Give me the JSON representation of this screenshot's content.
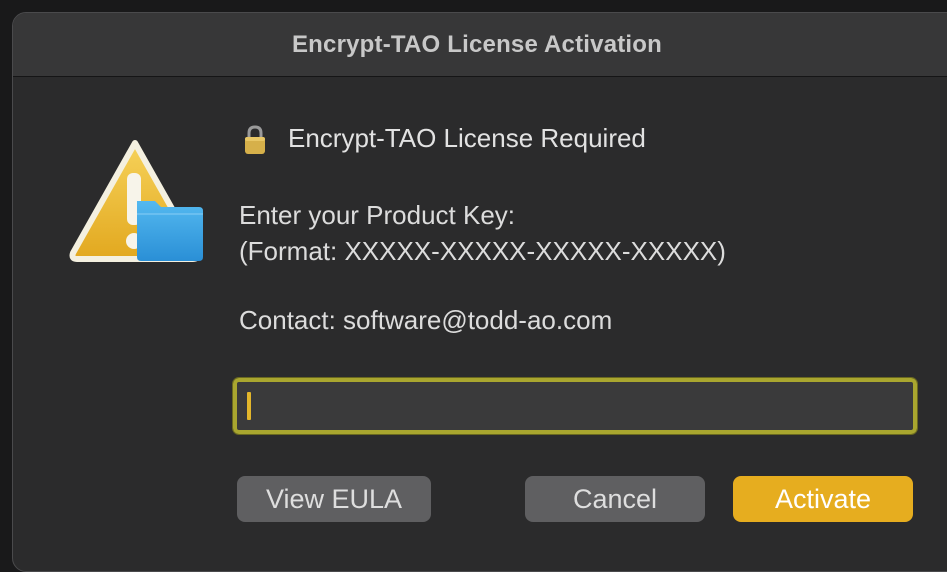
{
  "window": {
    "title": "Encrypt-TAO License Activation"
  },
  "message": {
    "heading": "Encrypt-TAO License Required",
    "prompt_line1": "Enter your Product Key:",
    "prompt_line2": "(Format: XXXXX-XXXXX-XXXXX-XXXXX)",
    "contact": "Contact: software@todd-ao.com"
  },
  "product_key_field": {
    "value": ""
  },
  "buttons": {
    "view_eula": "View EULA",
    "cancel": "Cancel",
    "activate": "Activate"
  },
  "icons": {
    "alert": "warning-triangle-with-folder-icon",
    "lock": "lock-icon"
  },
  "colors": {
    "accent": "#e6ad1f",
    "field_border": "#a9a62f",
    "dialog_bg": "#2b2b2c",
    "titlebar_bg": "#373738"
  }
}
